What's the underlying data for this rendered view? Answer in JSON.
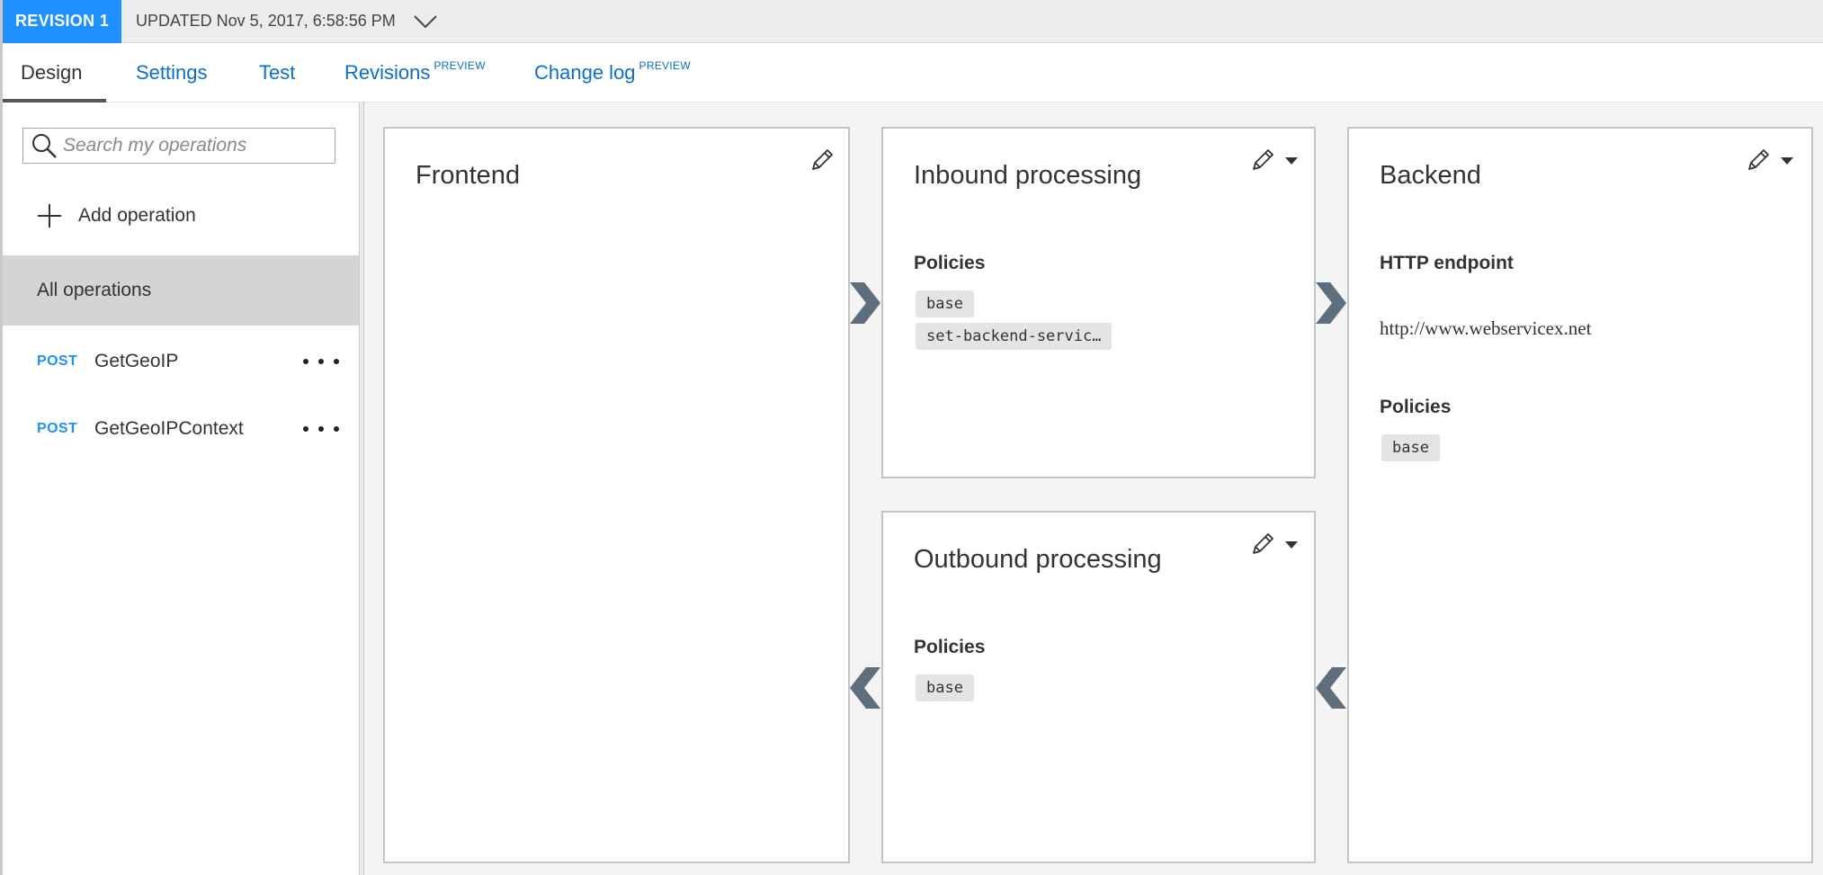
{
  "revision": {
    "badge": "REVISION 1",
    "updated": "UPDATED Nov 5, 2017, 6:58:56 PM"
  },
  "tabs": [
    {
      "label": "Design",
      "sup": ""
    },
    {
      "label": "Settings",
      "sup": ""
    },
    {
      "label": "Test",
      "sup": ""
    },
    {
      "label": "Revisions",
      "sup": "PREVIEW"
    },
    {
      "label": "Change log",
      "sup": "PREVIEW"
    }
  ],
  "sidebar": {
    "search_placeholder": "Search my operations",
    "add_operation": "Add operation",
    "all_operations": "All operations",
    "operations": [
      {
        "method": "POST",
        "name": "GetGeoIP"
      },
      {
        "method": "POST",
        "name": "GetGeoIPContext"
      }
    ]
  },
  "frontend": {
    "title": "Frontend"
  },
  "inbound": {
    "title": "Inbound processing",
    "policies_label": "Policies",
    "policies": [
      "base",
      "set-backend-servic…"
    ]
  },
  "outbound": {
    "title": "Outbound processing",
    "policies_label": "Policies",
    "policies": [
      "base"
    ]
  },
  "backend": {
    "title": "Backend",
    "endpoint_label": "HTTP endpoint",
    "endpoint_url": "http://www.webservicex.net",
    "policies_label": "Policies",
    "policies": [
      "base"
    ]
  },
  "colors": {
    "accent": "#1e90ff",
    "link": "#0a6ed1",
    "selected_row": "#d4d4d4",
    "arrow": "#5f6e7c"
  },
  "icons": {
    "edit": "pencil-icon",
    "dropdown": "caret-down-icon",
    "flow": "chevron-arrow-icon"
  }
}
